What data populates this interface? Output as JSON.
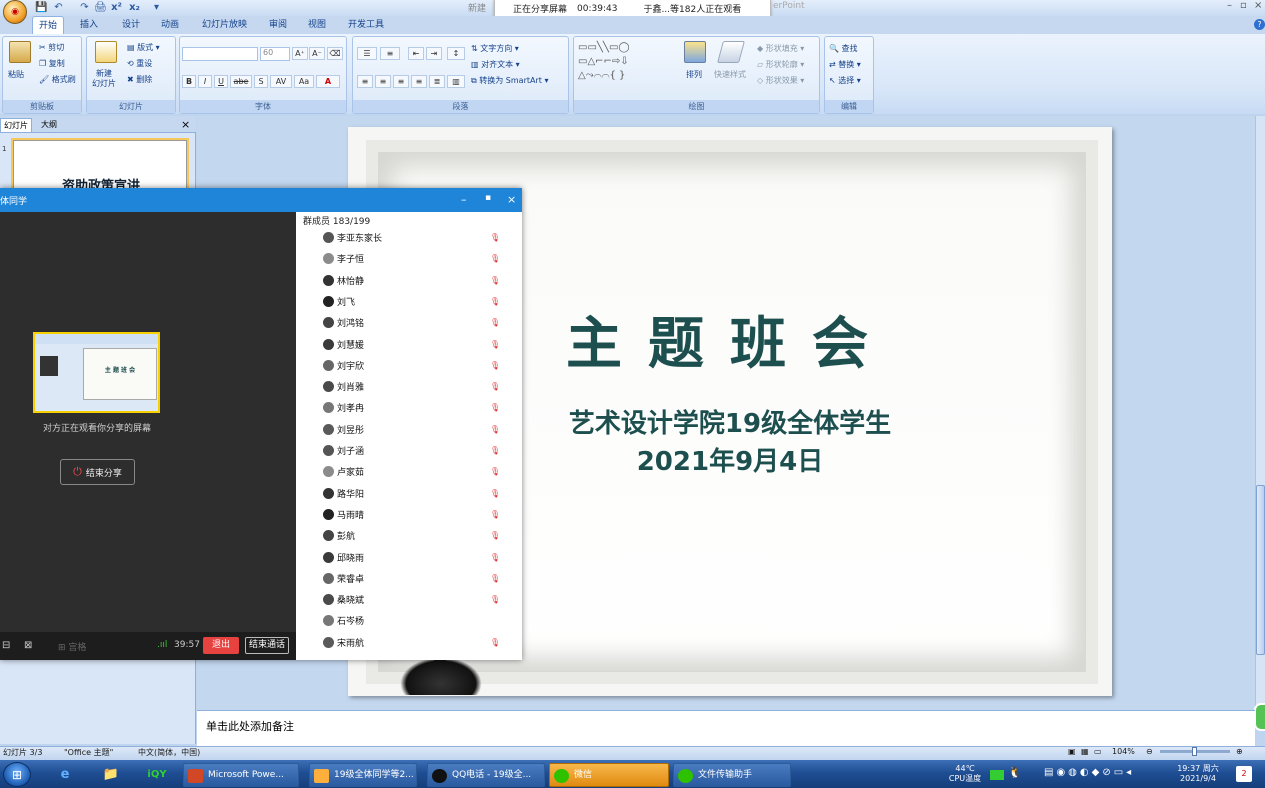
{
  "window": {
    "title_left": "新建",
    "title_right": "erPoint",
    "quick_access": [
      "💾",
      "↶",
      "↷",
      "🖨",
      "x²",
      "x₂",
      "▾"
    ]
  },
  "share_banner": {
    "status": "正在分享屏幕",
    "timer": "00:39:43",
    "viewers": "于鑫...等182人正在观看"
  },
  "ribbon": {
    "tabs": [
      "开始",
      "插入",
      "设计",
      "动画",
      "幻灯片放映",
      "审阅",
      "视图",
      "开发工具"
    ],
    "clipboard": {
      "paste": "粘贴",
      "cut": "剪切",
      "copy": "复制",
      "format_painter": "格式刷",
      "label": "剪贴板"
    },
    "slides": {
      "new_slide": "新建\n幻灯片",
      "layout": "版式",
      "reset": "重设",
      "delete": "删除",
      "label": "幻灯片"
    },
    "font": {
      "size": "60",
      "label": "字体",
      "bold": "B",
      "italic": "I",
      "underline": "U",
      "strike": "abe",
      "shadow": "S",
      "spacing": "AV",
      "case": "Aa",
      "color": "A"
    },
    "paragraph": {
      "text_direction": "文字方向",
      "align_text": "对齐文本",
      "smartart": "转换为 SmartArt",
      "label": "段落"
    },
    "drawing": {
      "arrange": "排列",
      "quick_styles": "快速样式",
      "shape_fill": "形状填充",
      "shape_outline": "形状轮廓",
      "shape_effects": "形状效果",
      "label": "绘图"
    },
    "editing": {
      "find": "查找",
      "replace": "替换",
      "select": "选择",
      "label": "编辑"
    }
  },
  "left_panel": {
    "tab_slides": "幻灯片",
    "tab_outline": "大纲",
    "close": "×",
    "thumb_number": "1",
    "thumb_title": "资助政策宣讲"
  },
  "slide": {
    "title": "主题班会",
    "subtitle1": "艺术设计学院19级全体学生",
    "subtitle2": "2021年9月4日"
  },
  "notes": {
    "placeholder": "单击此处添加备注"
  },
  "status_bar": {
    "slide_info": "幻灯片 3/3",
    "theme": "\"Office 主题\"",
    "language": "中文(简体，中国)",
    "zoom": "104%"
  },
  "qq_window": {
    "title": "体同学",
    "watching_text": "对方正在观看你分享的屏幕",
    "end_share": "结束分享",
    "grid": "宫格",
    "signal_time": "39:57",
    "exit": "退出",
    "end_call": "结束通话",
    "members_header": "群成员 183/199",
    "members": [
      {
        "name": "李亚东家长",
        "muted": true
      },
      {
        "name": "李子恒",
        "muted": true
      },
      {
        "name": "林怡静",
        "muted": true
      },
      {
        "name": "刘飞",
        "muted": true
      },
      {
        "name": "刘鸿铭",
        "muted": true
      },
      {
        "name": "刘慧媛",
        "muted": true
      },
      {
        "name": "刘宇欣",
        "muted": true
      },
      {
        "name": "刘肖雅",
        "muted": true
      },
      {
        "name": "刘孝冉",
        "muted": true
      },
      {
        "name": "刘昱彤",
        "muted": true
      },
      {
        "name": "刘子涵",
        "muted": true
      },
      {
        "name": "卢家茹",
        "muted": true
      },
      {
        "name": "路华阳",
        "muted": true
      },
      {
        "name": "马雨晴",
        "muted": true
      },
      {
        "name": "彭航",
        "muted": true
      },
      {
        "name": "邱晓雨",
        "muted": true
      },
      {
        "name": "荣睿卓",
        "muted": true
      },
      {
        "name": "桑晓斌",
        "muted": true
      },
      {
        "name": "石岑杨",
        "muted": false
      },
      {
        "name": "宋雨航",
        "muted": true
      }
    ]
  },
  "taskbar": {
    "items": [
      {
        "label": "Microsoft Powe...",
        "highlight": false
      },
      {
        "label": "19级全体同学等2...",
        "highlight": false
      },
      {
        "label": "QQ电话 - 19级全...",
        "highlight": false
      },
      {
        "label": "微信",
        "highlight": true
      },
      {
        "label": "文件传输助手",
        "highlight": false
      }
    ],
    "temp": "44℃",
    "temp_label": "CPU温度",
    "time": "19:37 周六",
    "date": "2021/9/4"
  }
}
